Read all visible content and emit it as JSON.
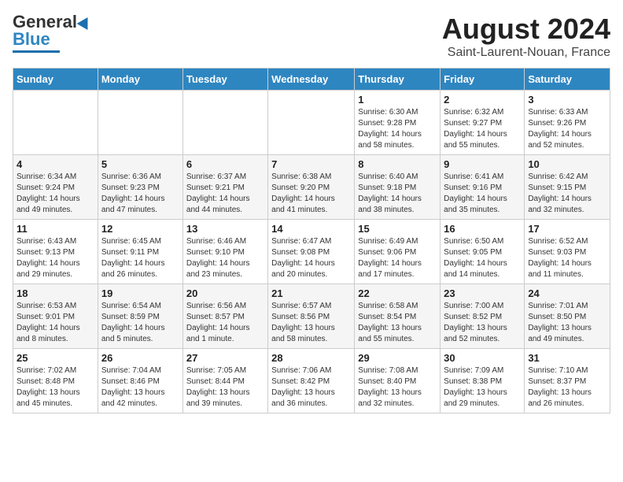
{
  "header": {
    "logo_line1": "General",
    "logo_line2": "Blue",
    "main_title": "August 2024",
    "subtitle": "Saint-Laurent-Nouan, France"
  },
  "days_of_week": [
    "Sunday",
    "Monday",
    "Tuesday",
    "Wednesday",
    "Thursday",
    "Friday",
    "Saturday"
  ],
  "weeks": [
    [
      {
        "num": "",
        "info": ""
      },
      {
        "num": "",
        "info": ""
      },
      {
        "num": "",
        "info": ""
      },
      {
        "num": "",
        "info": ""
      },
      {
        "num": "1",
        "info": "Sunrise: 6:30 AM\nSunset: 9:28 PM\nDaylight: 14 hours\nand 58 minutes."
      },
      {
        "num": "2",
        "info": "Sunrise: 6:32 AM\nSunset: 9:27 PM\nDaylight: 14 hours\nand 55 minutes."
      },
      {
        "num": "3",
        "info": "Sunrise: 6:33 AM\nSunset: 9:26 PM\nDaylight: 14 hours\nand 52 minutes."
      }
    ],
    [
      {
        "num": "4",
        "info": "Sunrise: 6:34 AM\nSunset: 9:24 PM\nDaylight: 14 hours\nand 49 minutes."
      },
      {
        "num": "5",
        "info": "Sunrise: 6:36 AM\nSunset: 9:23 PM\nDaylight: 14 hours\nand 47 minutes."
      },
      {
        "num": "6",
        "info": "Sunrise: 6:37 AM\nSunset: 9:21 PM\nDaylight: 14 hours\nand 44 minutes."
      },
      {
        "num": "7",
        "info": "Sunrise: 6:38 AM\nSunset: 9:20 PM\nDaylight: 14 hours\nand 41 minutes."
      },
      {
        "num": "8",
        "info": "Sunrise: 6:40 AM\nSunset: 9:18 PM\nDaylight: 14 hours\nand 38 minutes."
      },
      {
        "num": "9",
        "info": "Sunrise: 6:41 AM\nSunset: 9:16 PM\nDaylight: 14 hours\nand 35 minutes."
      },
      {
        "num": "10",
        "info": "Sunrise: 6:42 AM\nSunset: 9:15 PM\nDaylight: 14 hours\nand 32 minutes."
      }
    ],
    [
      {
        "num": "11",
        "info": "Sunrise: 6:43 AM\nSunset: 9:13 PM\nDaylight: 14 hours\nand 29 minutes."
      },
      {
        "num": "12",
        "info": "Sunrise: 6:45 AM\nSunset: 9:11 PM\nDaylight: 14 hours\nand 26 minutes."
      },
      {
        "num": "13",
        "info": "Sunrise: 6:46 AM\nSunset: 9:10 PM\nDaylight: 14 hours\nand 23 minutes."
      },
      {
        "num": "14",
        "info": "Sunrise: 6:47 AM\nSunset: 9:08 PM\nDaylight: 14 hours\nand 20 minutes."
      },
      {
        "num": "15",
        "info": "Sunrise: 6:49 AM\nSunset: 9:06 PM\nDaylight: 14 hours\nand 17 minutes."
      },
      {
        "num": "16",
        "info": "Sunrise: 6:50 AM\nSunset: 9:05 PM\nDaylight: 14 hours\nand 14 minutes."
      },
      {
        "num": "17",
        "info": "Sunrise: 6:52 AM\nSunset: 9:03 PM\nDaylight: 14 hours\nand 11 minutes."
      }
    ],
    [
      {
        "num": "18",
        "info": "Sunrise: 6:53 AM\nSunset: 9:01 PM\nDaylight: 14 hours\nand 8 minutes."
      },
      {
        "num": "19",
        "info": "Sunrise: 6:54 AM\nSunset: 8:59 PM\nDaylight: 14 hours\nand 5 minutes."
      },
      {
        "num": "20",
        "info": "Sunrise: 6:56 AM\nSunset: 8:57 PM\nDaylight: 14 hours\nand 1 minute."
      },
      {
        "num": "21",
        "info": "Sunrise: 6:57 AM\nSunset: 8:56 PM\nDaylight: 13 hours\nand 58 minutes."
      },
      {
        "num": "22",
        "info": "Sunrise: 6:58 AM\nSunset: 8:54 PM\nDaylight: 13 hours\nand 55 minutes."
      },
      {
        "num": "23",
        "info": "Sunrise: 7:00 AM\nSunset: 8:52 PM\nDaylight: 13 hours\nand 52 minutes."
      },
      {
        "num": "24",
        "info": "Sunrise: 7:01 AM\nSunset: 8:50 PM\nDaylight: 13 hours\nand 49 minutes."
      }
    ],
    [
      {
        "num": "25",
        "info": "Sunrise: 7:02 AM\nSunset: 8:48 PM\nDaylight: 13 hours\nand 45 minutes."
      },
      {
        "num": "26",
        "info": "Sunrise: 7:04 AM\nSunset: 8:46 PM\nDaylight: 13 hours\nand 42 minutes."
      },
      {
        "num": "27",
        "info": "Sunrise: 7:05 AM\nSunset: 8:44 PM\nDaylight: 13 hours\nand 39 minutes."
      },
      {
        "num": "28",
        "info": "Sunrise: 7:06 AM\nSunset: 8:42 PM\nDaylight: 13 hours\nand 36 minutes."
      },
      {
        "num": "29",
        "info": "Sunrise: 7:08 AM\nSunset: 8:40 PM\nDaylight: 13 hours\nand 32 minutes."
      },
      {
        "num": "30",
        "info": "Sunrise: 7:09 AM\nSunset: 8:38 PM\nDaylight: 13 hours\nand 29 minutes."
      },
      {
        "num": "31",
        "info": "Sunrise: 7:10 AM\nSunset: 8:37 PM\nDaylight: 13 hours\nand 26 minutes."
      }
    ]
  ]
}
